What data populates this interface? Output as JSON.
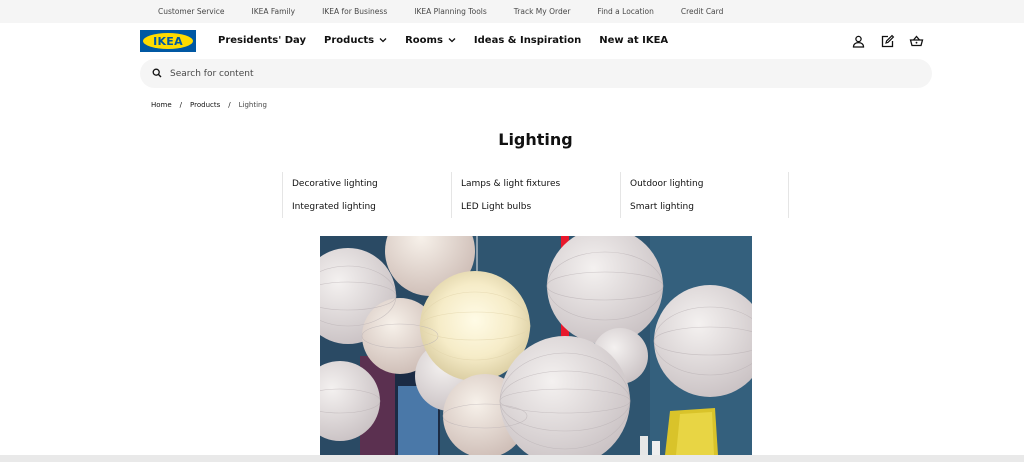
{
  "utility_links": [
    "Customer Service",
    "IKEA Family",
    "IKEA for Business",
    "IKEA Planning Tools",
    "Track My Order",
    "Find a Location",
    "Credit Card"
  ],
  "logo": {
    "text": "IKEA"
  },
  "nav": [
    {
      "label": "Presidents' Day",
      "dropdown": false
    },
    {
      "label": "Products",
      "dropdown": true
    },
    {
      "label": "Rooms",
      "dropdown": true
    },
    {
      "label": "Ideas & Inspiration",
      "dropdown": false
    },
    {
      "label": "New at IKEA",
      "dropdown": false
    }
  ],
  "header_icons": [
    "user-icon",
    "shopping-list-icon",
    "cart-icon"
  ],
  "search": {
    "placeholder": "Search for content"
  },
  "breadcrumb": {
    "home": "Home",
    "products": "Products",
    "current": "Lighting"
  },
  "page_title": "Lighting",
  "categories": [
    "Decorative lighting",
    "Lamps & light fixtures",
    "Outdoor lighting",
    "Integrated lighting",
    "LED Light bulbs",
    "Smart lighting"
  ],
  "colors": {
    "ikea_blue": "#0058a3",
    "ikea_yellow": "#ffdb00",
    "search_bg": "#f5f5f5",
    "wall_blue": "#2f5570"
  }
}
